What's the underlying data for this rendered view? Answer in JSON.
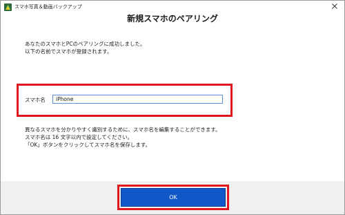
{
  "window": {
    "app_title": "スマホ写真＆動画バックアップ",
    "close_glyph": "✕"
  },
  "dialog": {
    "title": "新規スマホのペアリング",
    "intro_lines": [
      "あなたのスマホとPCのペアリングに成功しました。",
      "以下の名前でスマホが登録されます。"
    ],
    "phone_name": {
      "label": "スマホ名",
      "value": "iPhone"
    },
    "help_lines": [
      "異なるスマホを分かりやすく識別するために、スマホ名を編集することができます。",
      "スマホ名は 16 文字以内で設定してください。",
      "「OK」ボタンをクリックしてスマホ名を保存します。"
    ],
    "ok_label": "OK"
  },
  "colors": {
    "highlight": "#e0161e",
    "ok_button": "#1057c8",
    "footer": "#f0f0f0",
    "input_border": "#5b8fd8"
  },
  "icons": {
    "app": "app-logo-icon",
    "close": "close-icon"
  }
}
